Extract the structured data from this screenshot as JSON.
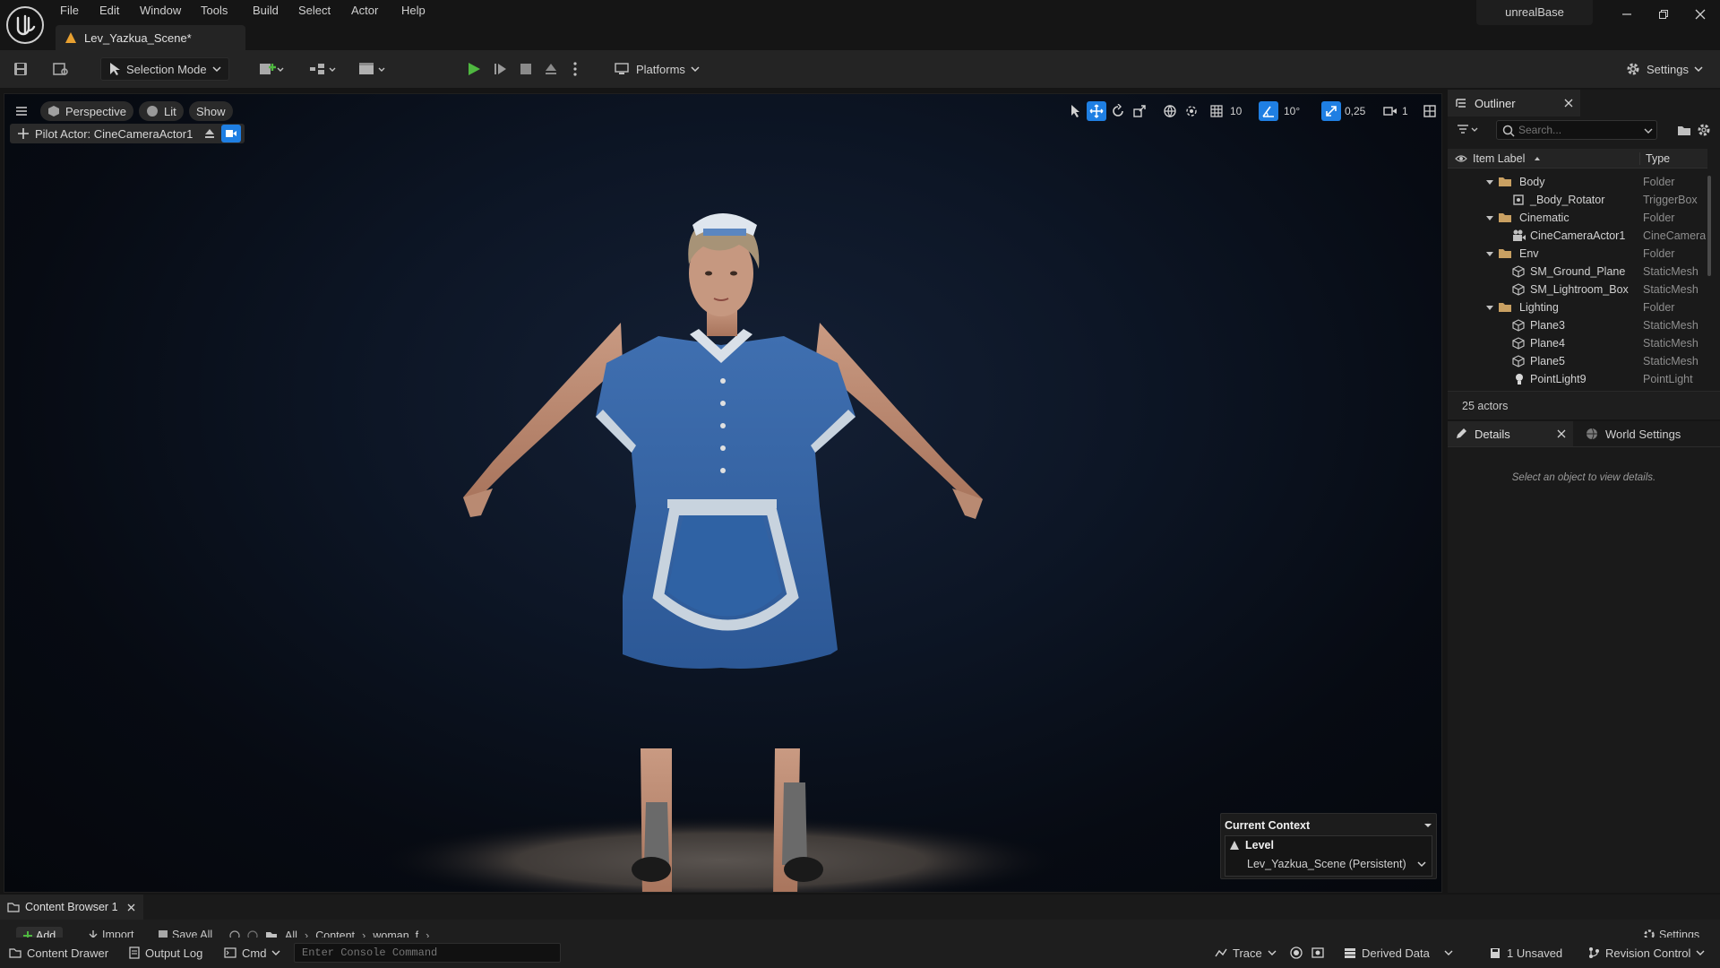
{
  "menu": {
    "items": [
      "File",
      "Edit",
      "Window",
      "Tools",
      "Build",
      "Select",
      "Actor",
      "Help"
    ]
  },
  "project": {
    "name": "unrealBase"
  },
  "level_tab": {
    "label": "Lev_Yazkua_Scene*"
  },
  "toolbar": {
    "selection_mode": "Selection Mode",
    "platforms": "Platforms",
    "settings": "Settings"
  },
  "viewport": {
    "perspective": "Perspective",
    "lit": "Lit",
    "show": "Show",
    "pilot_actor": "Pilot Actor: CineCameraActor1",
    "grid_snap": "10",
    "rotation_snap": "10°",
    "scale_snap": "0,25",
    "camera_speed": "1",
    "accent_color": "#1f7fe3",
    "character": "Woman in blue waitress uniform with white apron and cap standing in A-pose on spotlit floor"
  },
  "current_context": {
    "title": "Current Context",
    "level_label": "Level",
    "level_value": "Lev_Yazkua_Scene (Persistent)"
  },
  "outliner": {
    "title": "Outliner",
    "search_placeholder": "Search...",
    "col_label": "Item Label",
    "col_type": "Type",
    "rows": [
      {
        "label": "Body",
        "type": "Folder"
      },
      {
        "label": "_Body_Rotator",
        "type": "TriggerBox"
      },
      {
        "label": "Cinematic",
        "type": "Folder"
      },
      {
        "label": "CineCameraActor1",
        "type": "CineCamera"
      },
      {
        "label": "Env",
        "type": "Folder"
      },
      {
        "label": "SM_Ground_Plane",
        "type": "StaticMesh"
      },
      {
        "label": "SM_Lightroom_Box",
        "type": "StaticMesh"
      },
      {
        "label": "Lighting",
        "type": "Folder"
      },
      {
        "label": "Plane3",
        "type": "StaticMesh"
      },
      {
        "label": "Plane4",
        "type": "StaticMesh"
      },
      {
        "label": "Plane5",
        "type": "StaticMesh"
      },
      {
        "label": "PointLight9",
        "type": "PointLight"
      }
    ],
    "actor_count": "25 actors"
  },
  "details": {
    "tab_details": "Details",
    "tab_world": "World Settings",
    "empty_message": "Select an object to view details."
  },
  "content_browser": {
    "tab": "Content Browser 1",
    "add": "Add",
    "import": "Import",
    "save_all": "Save All",
    "path": [
      "All",
      "Content",
      "woman_f"
    ],
    "settings": "Settings"
  },
  "statusbar": {
    "content_drawer": "Content Drawer",
    "output_log": "Output Log",
    "cmd": "Cmd",
    "console_placeholder": "Enter Console Command",
    "trace": "Trace",
    "derived_data": "Derived Data",
    "unsaved": "1 Unsaved",
    "revision_control": "Revision Control"
  }
}
